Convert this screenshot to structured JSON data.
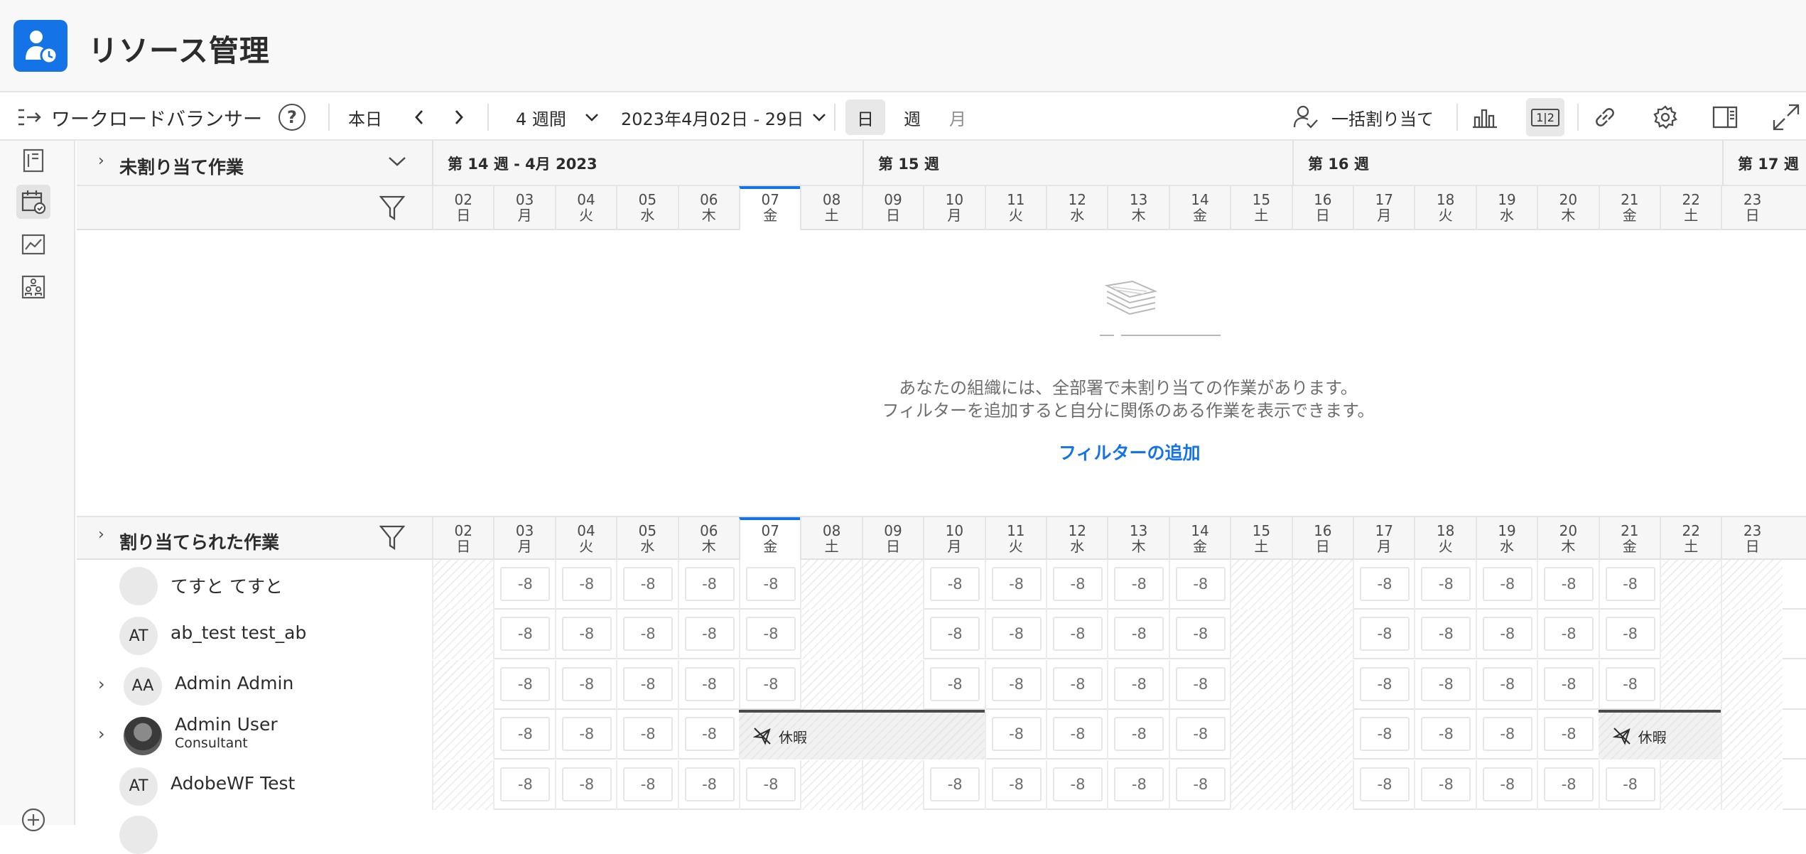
{
  "app": {
    "title": "リソース管理"
  },
  "toolbar": {
    "view_title": "ワークロードバランサー",
    "help": "?",
    "today": "本日",
    "prev": "‹",
    "next": "›",
    "period": "4 週間",
    "date_range": "2023年4月02日 - 29日",
    "view_day": "日",
    "view_week": "週",
    "view_month": "月",
    "bulk_assign": "一括割り当て",
    "split_label": "1|2"
  },
  "unassigned": {
    "title": "未割り当て作業",
    "empty_line1": "あなたの組織には、全部署で未割り当ての作業があります。",
    "empty_line2": "フィルターを追加すると自分に関係のある作業を表示できます。",
    "add_filter": "フィルターの追加"
  },
  "assigned": {
    "title": "割り当てられた作業"
  },
  "weeks": [
    "第 14 週 - 4月 2023",
    "第 15 週",
    "第 16 週",
    "第 17 週"
  ],
  "days": [
    {
      "d": "02",
      "w": "日"
    },
    {
      "d": "03",
      "w": "月"
    },
    {
      "d": "04",
      "w": "火"
    },
    {
      "d": "05",
      "w": "水"
    },
    {
      "d": "06",
      "w": "木"
    },
    {
      "d": "07",
      "w": "金"
    },
    {
      "d": "08",
      "w": "土"
    },
    {
      "d": "09",
      "w": "日"
    },
    {
      "d": "10",
      "w": "月"
    },
    {
      "d": "11",
      "w": "火"
    },
    {
      "d": "12",
      "w": "水"
    },
    {
      "d": "13",
      "w": "木"
    },
    {
      "d": "14",
      "w": "金"
    },
    {
      "d": "15",
      "w": "土"
    },
    {
      "d": "16",
      "w": "日"
    },
    {
      "d": "17",
      "w": "月"
    },
    {
      "d": "18",
      "w": "火"
    },
    {
      "d": "19",
      "w": "水"
    },
    {
      "d": "20",
      "w": "木"
    },
    {
      "d": "21",
      "w": "金"
    },
    {
      "d": "22",
      "w": "土"
    },
    {
      "d": "23",
      "w": "日"
    }
  ],
  "capacity_value": "-8",
  "leave_label": "休暇",
  "users": [
    {
      "initials": "",
      "name": "てすと てすと",
      "role": "",
      "expandable": false,
      "photo": false
    },
    {
      "initials": "AT",
      "name": "ab_test test_ab",
      "role": "",
      "expandable": false,
      "photo": false
    },
    {
      "initials": "AA",
      "name": "Admin Admin",
      "role": "",
      "expandable": true,
      "photo": false
    },
    {
      "initials": "",
      "name": "Admin User",
      "role": "Consultant",
      "expandable": true,
      "photo": true
    },
    {
      "initials": "AT",
      "name": "AdobeWF Test",
      "role": "",
      "expandable": false,
      "photo": false
    }
  ]
}
